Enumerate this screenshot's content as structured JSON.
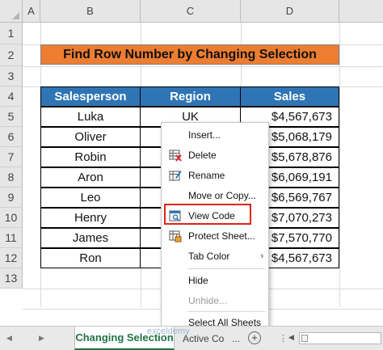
{
  "columns": [
    "A",
    "B",
    "C",
    "D"
  ],
  "rows": [
    "1",
    "2",
    "3",
    "4",
    "5",
    "6",
    "7",
    "8",
    "9",
    "10",
    "11",
    "12",
    "13"
  ],
  "title": "Find Row Number by Changing Selection",
  "table": {
    "headers": [
      "Salesperson",
      "Region",
      "Sales"
    ],
    "data": [
      [
        "Luka",
        "UK",
        "$4,567,673"
      ],
      [
        "Oliver",
        "",
        "$5,068,179"
      ],
      [
        "Robin",
        "",
        "$5,678,876"
      ],
      [
        "Aron",
        "",
        "$6,069,191"
      ],
      [
        "Leo",
        "",
        "$6,569,767"
      ],
      [
        "Henry",
        "",
        "$7,070,273"
      ],
      [
        "James",
        "",
        "$7,570,770"
      ],
      [
        "Ron",
        "",
        "$4,567,673"
      ]
    ]
  },
  "context_menu": {
    "items": [
      {
        "label": "Insert...",
        "icon": "",
        "disabled": false
      },
      {
        "label": "Delete",
        "icon": "delete-sheet-icon",
        "disabled": false
      },
      {
        "label": "Rename",
        "icon": "rename-sheet-icon",
        "disabled": false
      },
      {
        "label": "Move or Copy...",
        "icon": "",
        "disabled": false
      },
      {
        "label": "View Code",
        "icon": "view-code-icon",
        "disabled": false
      },
      {
        "label": "Protect Sheet...",
        "icon": "protect-sheet-icon",
        "disabled": false
      },
      {
        "label": "Tab Color",
        "icon": "",
        "disabled": false,
        "submenu": true
      },
      {
        "label": "Hide",
        "icon": "",
        "disabled": false
      },
      {
        "label": "Unhide...",
        "icon": "",
        "disabled": true
      },
      {
        "label": "Select All Sheets",
        "icon": "",
        "disabled": false
      }
    ]
  },
  "sheet_tabs": {
    "active": "Changing Selection",
    "other": "Active Co",
    "more": "...",
    "add": "+",
    "prev": "◀",
    "next": "▶"
  },
  "watermark": "exceldemy",
  "colors": {
    "title_fill": "#ed7d31",
    "header_fill": "#2f75b5",
    "highlight_border": "#e0241b",
    "active_tab": "#217346"
  }
}
